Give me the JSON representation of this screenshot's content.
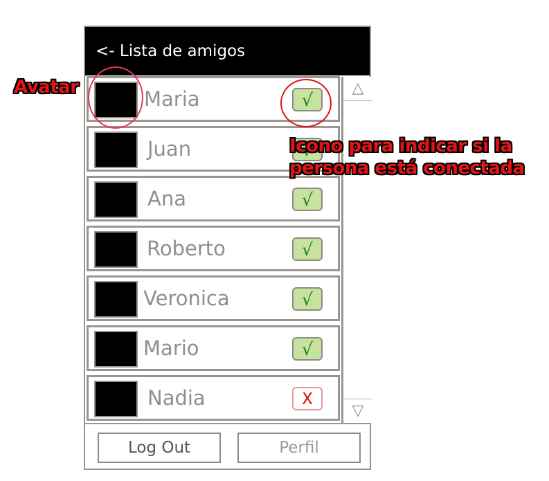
{
  "header": {
    "title": "<- Lista de amigos"
  },
  "friends": [
    {
      "name": "Maria",
      "status": "online",
      "status_icon": "√"
    },
    {
      "name": "Juan",
      "status": "online",
      "status_icon": "√"
    },
    {
      "name": "Ana",
      "status": "online",
      "status_icon": "√"
    },
    {
      "name": "Roberto",
      "status": "online",
      "status_icon": "√"
    },
    {
      "name": "Veronica",
      "status": "online",
      "status_icon": "√"
    },
    {
      "name": "Mario",
      "status": "online",
      "status_icon": "√"
    },
    {
      "name": "Nadia",
      "status": "offline",
      "status_icon": "X"
    }
  ],
  "scrollbar": {
    "up_icon": "△",
    "down_icon": "▽"
  },
  "footer": {
    "logout_label": "Log Out",
    "profile_label": "Perfil"
  },
  "annotations": {
    "avatar": "Avatar",
    "icon_line1": "Icono para indicar si la",
    "icon_line2": "persona está conectada"
  },
  "colors": {
    "header_bg": "#000000",
    "online_bg": "#c6e29e",
    "online_check": "#1e7f1e",
    "offline_x": "#e00000",
    "annotation": "#e31414"
  }
}
